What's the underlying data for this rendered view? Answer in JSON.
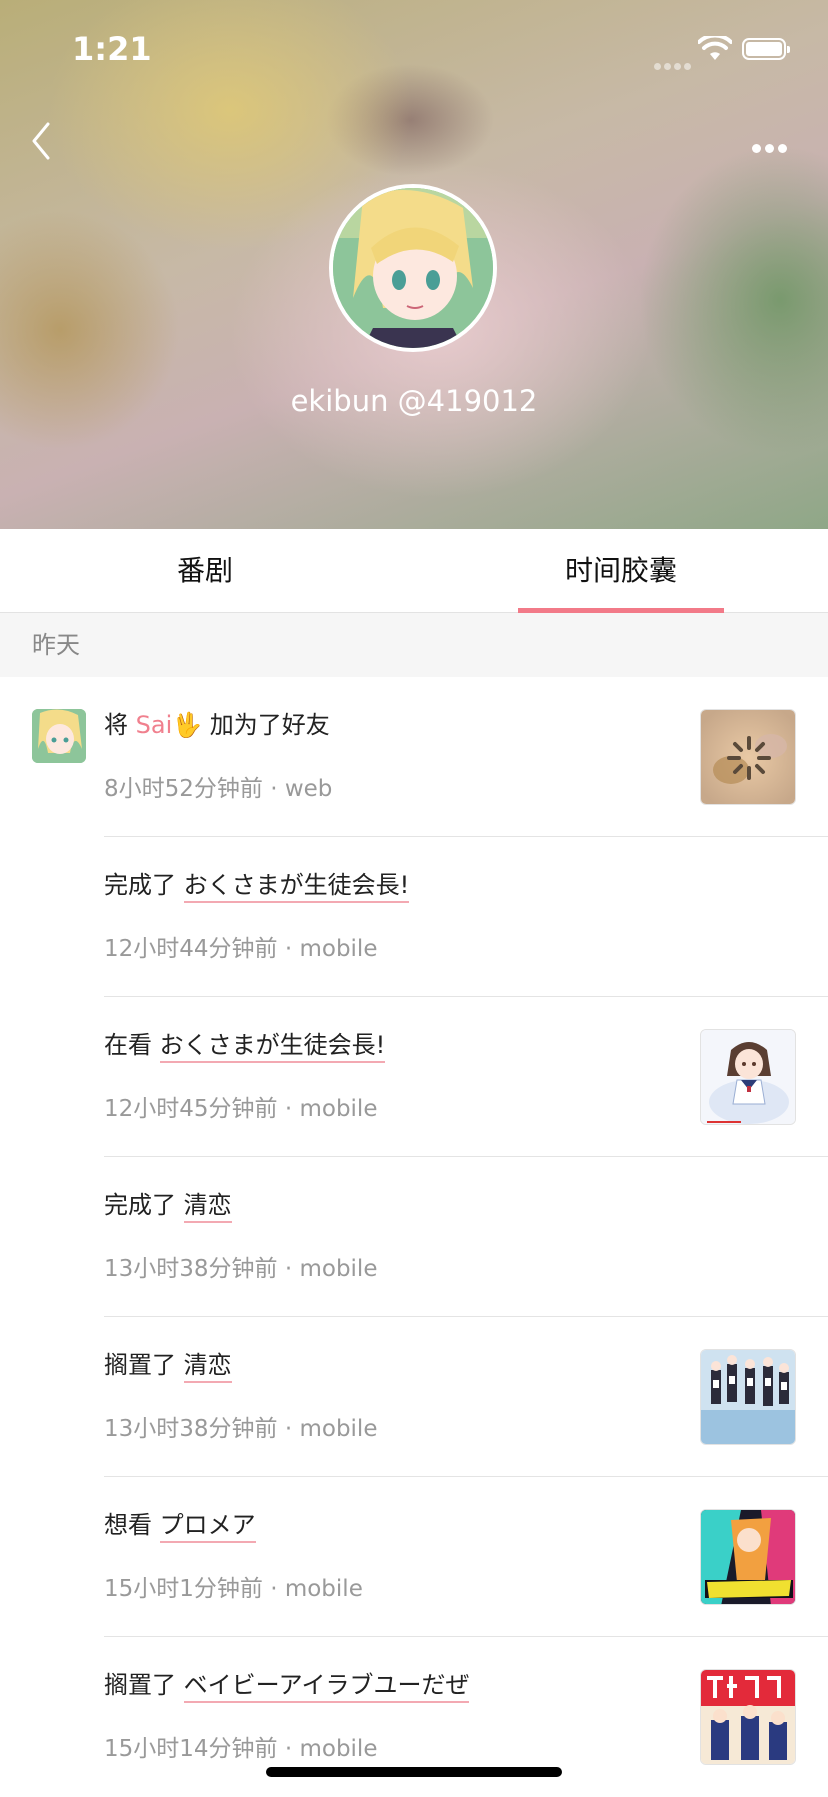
{
  "status_bar": {
    "time": "1:21"
  },
  "profile": {
    "username": "ekibun @419012"
  },
  "tabs": [
    {
      "label": "番剧",
      "selected": false
    },
    {
      "label": "时间胶囊",
      "selected": true
    }
  ],
  "section": {
    "label": "昨天"
  },
  "timeline": [
    {
      "action": "将",
      "friend": "Sai🖖",
      "action_suffix": "加为了好友",
      "meta": "8小时52分钟前 · web"
    },
    {
      "action": "完成了",
      "subject": "おくさまが生徒会長!",
      "meta": "12小时44分钟前 · mobile"
    },
    {
      "action": "在看",
      "subject": "おくさまが生徒会長!",
      "meta": "12小时45分钟前 · mobile"
    },
    {
      "action": "完成了",
      "subject": "清恋",
      "meta": "13小时38分钟前 · mobile"
    },
    {
      "action": "搁置了",
      "subject": "清恋",
      "meta": "13小时38分钟前 · mobile"
    },
    {
      "action": "想看",
      "subject": "プロメア",
      "meta": "15小时1分钟前 · mobile"
    },
    {
      "action": "搁置了",
      "subject": "ベイビーアイラブユーだぜ",
      "meta": "15小时14分钟前 · mobile"
    }
  ],
  "colors": {
    "accent": "#f27a88",
    "friend_link": "#f0808e",
    "underline": "#f3a9b2"
  }
}
